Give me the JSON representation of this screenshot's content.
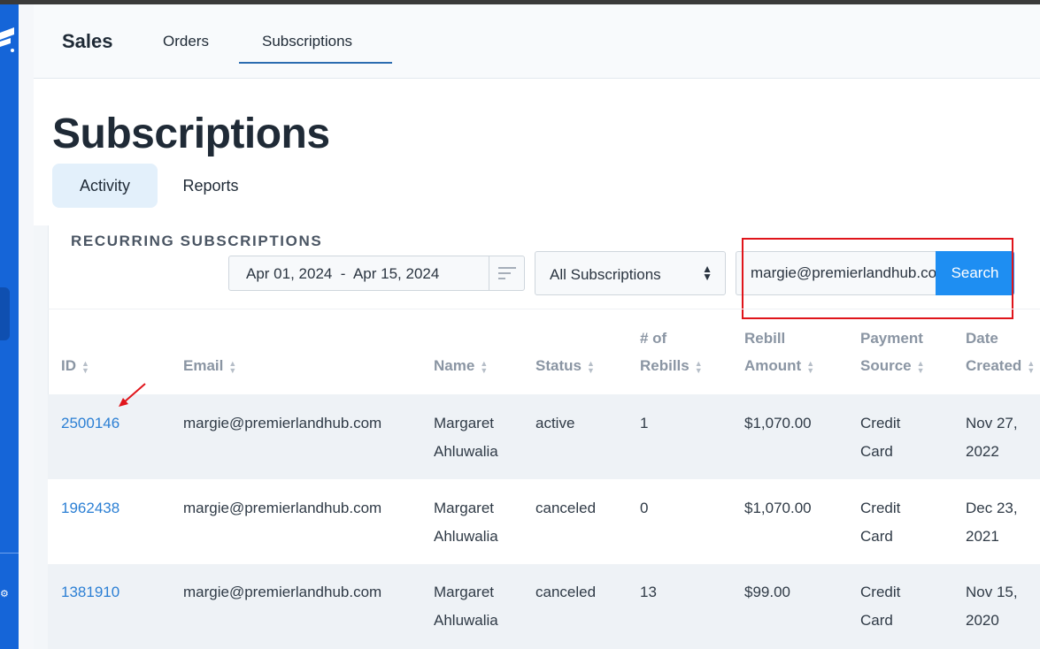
{
  "header": {
    "brand": "Sales",
    "tabs": [
      {
        "label": "Orders"
      },
      {
        "label": "Subscriptions",
        "active": true
      }
    ]
  },
  "page": {
    "title": "Subscriptions",
    "subtabs": [
      {
        "label": "Activity",
        "active": true
      },
      {
        "label": "Reports"
      }
    ]
  },
  "filters": {
    "section_label": "RECURRING SUBSCRIPTIONS",
    "date_range": "Apr 01, 2024  -  Apr 15, 2024",
    "subscription_filter": "All Subscriptions",
    "search_value": "margie@premierlandhub.com",
    "search_button": "Search"
  },
  "table": {
    "columns": [
      {
        "key": "id",
        "lines": [
          "ID"
        ]
      },
      {
        "key": "email",
        "lines": [
          "Email"
        ]
      },
      {
        "key": "name",
        "lines": [
          "Name"
        ]
      },
      {
        "key": "status",
        "lines": [
          "Status"
        ]
      },
      {
        "key": "rebills",
        "lines": [
          "# of",
          "Rebills"
        ]
      },
      {
        "key": "rebill_amount",
        "lines": [
          "Rebill",
          "Amount"
        ]
      },
      {
        "key": "payment_source",
        "lines": [
          "Payment",
          "Source"
        ]
      },
      {
        "key": "date_created",
        "lines": [
          "Date",
          "Created"
        ]
      }
    ],
    "rows": [
      {
        "id": "2500146",
        "email": "margie@premierlandhub.com",
        "name": [
          "Margaret",
          "Ahluwalia"
        ],
        "status": "active",
        "rebills": "1",
        "rebill_amount": "$1,070.00",
        "payment_source": [
          "Credit",
          "Card"
        ],
        "date_created": [
          "Nov 27,",
          "2022"
        ]
      },
      {
        "id": "1962438",
        "email": "margie@premierlandhub.com",
        "name": [
          "Margaret",
          "Ahluwalia"
        ],
        "status": "canceled",
        "rebills": "0",
        "rebill_amount": "$1,070.00",
        "payment_source": [
          "Credit",
          "Card"
        ],
        "date_created": [
          "Dec 23,",
          "2021"
        ]
      },
      {
        "id": "1381910",
        "email": "margie@premierlandhub.com",
        "name": [
          "Margaret",
          "Ahluwalia"
        ],
        "status": "canceled",
        "rebills": "13",
        "rebill_amount": "$99.00",
        "payment_source": [
          "Credit",
          "Card"
        ],
        "date_created": [
          "Nov 15,",
          "2020"
        ]
      }
    ]
  },
  "colors": {
    "sidebar": "#1565d8",
    "link": "#2b7fd4",
    "search_button": "#1e8ef2",
    "annotation_red": "#e0151b",
    "row_stripe": "#eef2f6"
  },
  "icons": {
    "date_range_toggle": "lines-icon",
    "select_arrow": "sort-arrows-icon",
    "sort": "sort-arrows-icon",
    "annotation": "red-arrow-icon"
  }
}
